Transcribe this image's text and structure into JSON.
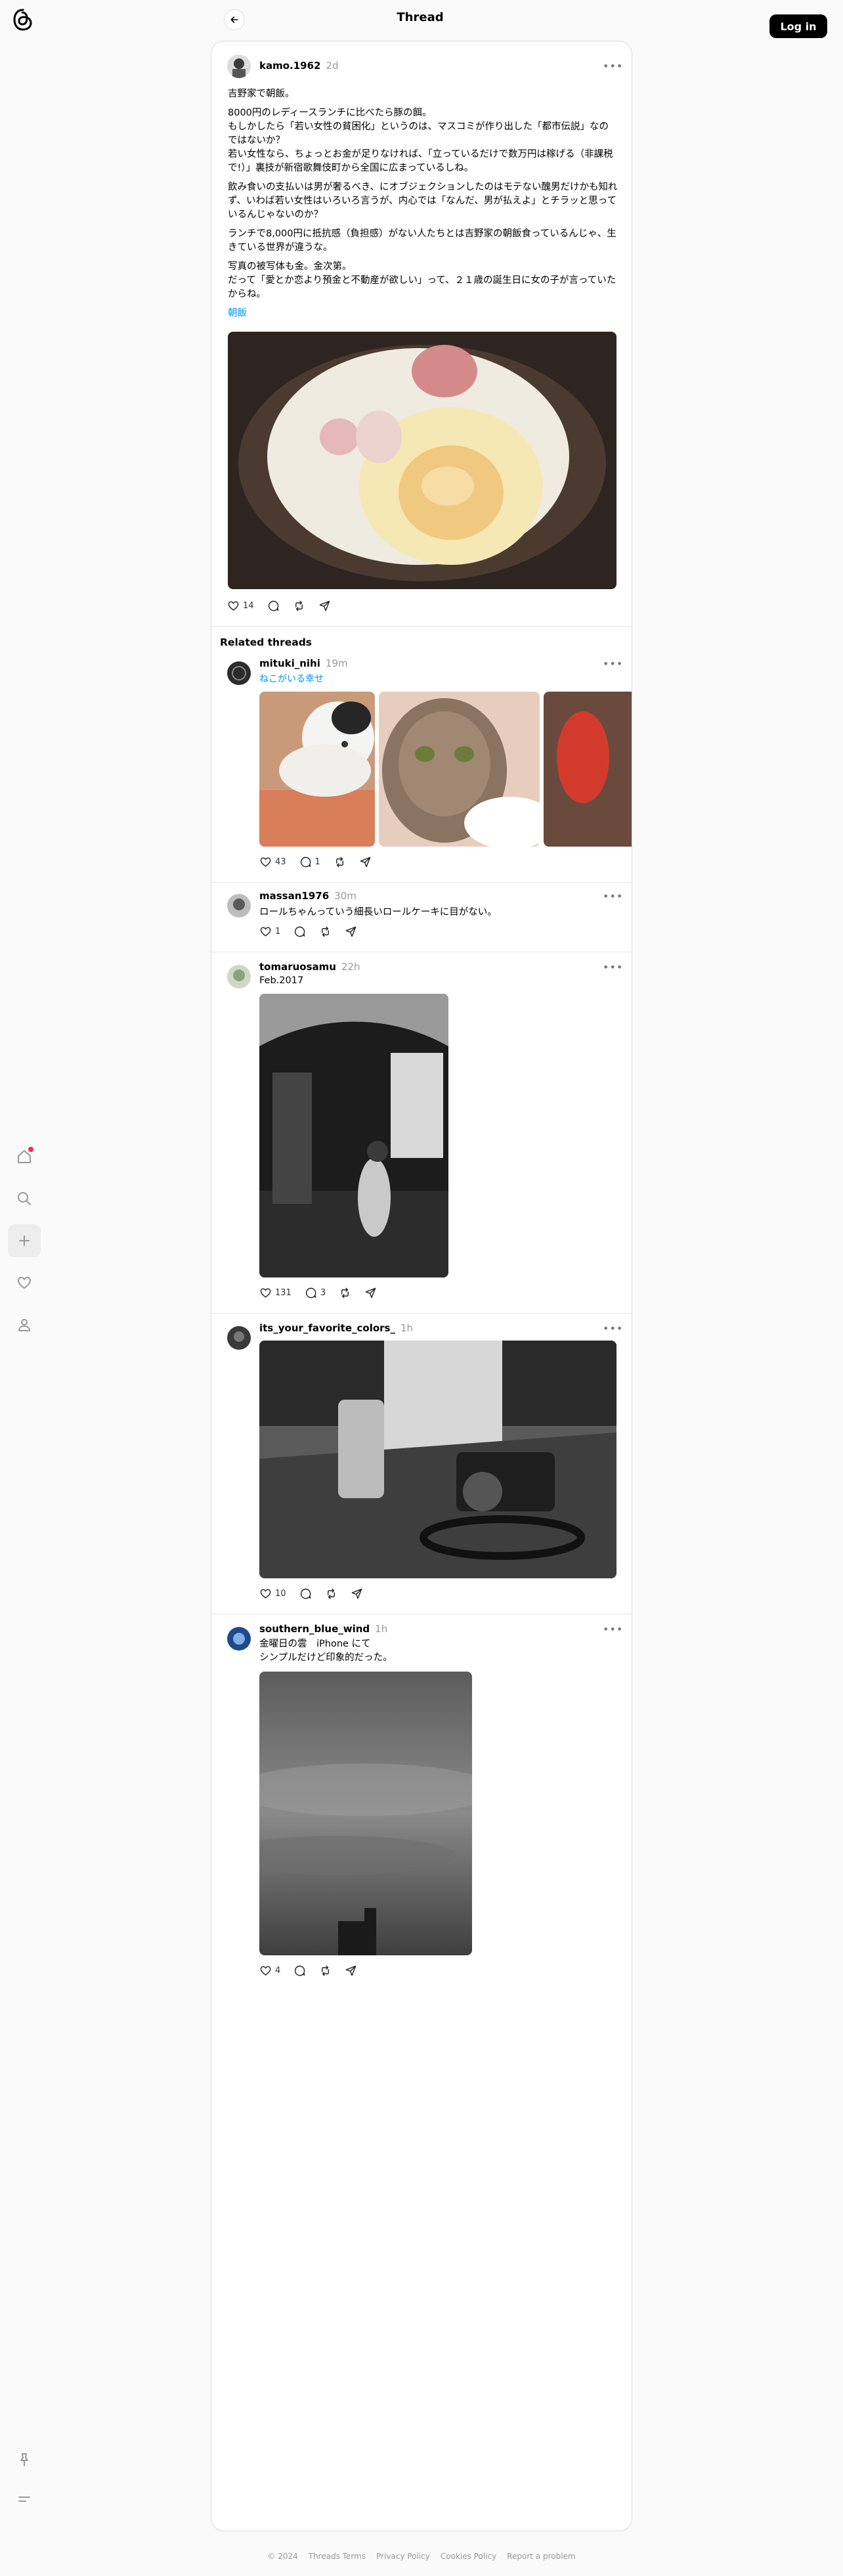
{
  "header": {
    "title": "Thread",
    "login_label": "Log in"
  },
  "nav": {
    "logo": "threads-logo",
    "items": [
      "home-icon",
      "search-icon",
      "new-post-icon",
      "activity-icon",
      "profile-icon"
    ],
    "bottom": [
      "pin-icon",
      "menu-icon"
    ],
    "notification_color": "#ff2a55"
  },
  "main_post": {
    "username": "kamo.1962",
    "time": "2d",
    "paragraphs": [
      "吉野家で朝飯。",
      "8000円のレディースランチに比べたら豚の餌。\nもしかしたら「若い女性の貧困化」というのは、マスコミが作り出した「都市伝説」なのではないか？\n若い女性なら、ちょっとお金が足りなければ、「立っているだけで数万円は稼げる（非課税で!）」裏技が新宿歌舞伎町から全国に広まっているしね。",
      "飲み食いの支払いは男が奢るべき、にオブジェクションしたのはモテない醜男だけかも知れず、いわば若い女性はいろいろ言うが、内心では「なんだ、男が払えよ」とチラッと思っているんじゃないのか？",
      "ランチで8,000円に抵抗感（負担感）がない人たちとは吉野家の朝飯食っているんじゃ、生きている世界が違うな。",
      "写真の被写体も金。金次第。\nだって「愛とか恋より預金と不動産が欲しい」って、２１歳の誕生日に女の子が言っていたからね。"
    ],
    "tag": "朝飯",
    "likes": "14"
  },
  "related_title": "Related threads",
  "related": [
    {
      "username": "mituki_nihi",
      "time": "19m",
      "tag": "ねこがいる幸せ",
      "likes": "43",
      "replies": "1"
    },
    {
      "username": "massan1976",
      "time": "30m",
      "text": "ロールちゃんっていう細長いロールケーキに目がない。",
      "likes": "1"
    },
    {
      "username": "tomaruosamu",
      "time": "22h",
      "text": "Feb.2017",
      "likes": "131",
      "replies": "3"
    },
    {
      "username": "its_your_favorite_colors_",
      "time": "1h",
      "likes": "10"
    },
    {
      "username": "southern_blue_wind",
      "time": "1h",
      "text": "金曜日の雲　iPhone にて\nシンプルだけど印象的だった。",
      "likes": "4"
    }
  ],
  "footer": [
    "© 2024",
    "Threads Terms",
    "Privacy Policy",
    "Cookies Policy",
    "Report a problem"
  ]
}
